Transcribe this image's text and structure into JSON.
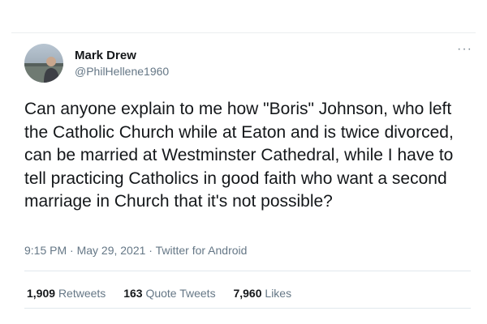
{
  "tweet": {
    "author": {
      "display_name": "Mark Drew",
      "handle": "@PhilHellene1960"
    },
    "more_icon": "more-horizontal-icon",
    "text": "Can anyone explain to me how \"Boris\" Johnson,  who left the Catholic Church while at Eaton and is twice divorced, can be married at Westminster Cathedral, while I have to tell practicing Catholics in good faith who want a second marriage in Church that it's not possible?",
    "meta": "9:15 PM · May 29, 2021 · Twitter for Android",
    "stats": {
      "retweets_count": "1,909",
      "retweets_label": "Retweets",
      "quote_count": "163",
      "quote_label": "Quote Tweets",
      "likes_count": "7,960",
      "likes_label": "Likes"
    },
    "colors": {
      "text": "#14171a",
      "secondary": "#657786",
      "divider": "#e1e8ed"
    }
  }
}
